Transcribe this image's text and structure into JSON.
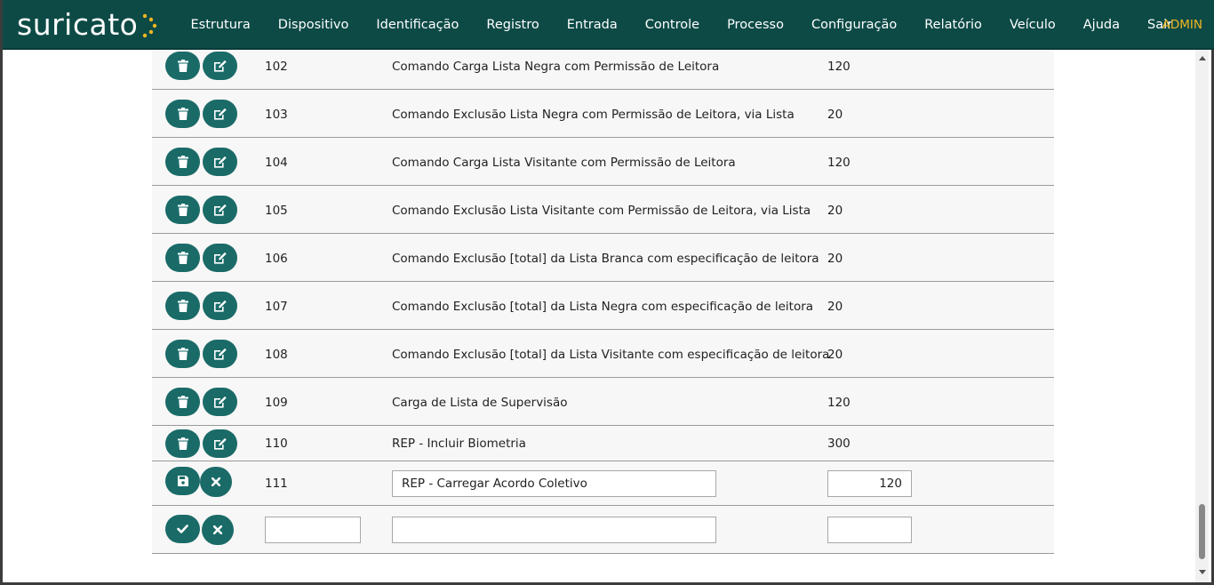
{
  "app": {
    "logo_text": "suricato"
  },
  "nav": {
    "items": [
      "Estrutura",
      "Dispositivo",
      "Identificação",
      "Registro",
      "Entrada",
      "Controle",
      "Processo",
      "Configuração",
      "Relatório",
      "Veículo",
      "Ajuda",
      "Sair"
    ],
    "user": "ADMIN"
  },
  "colors": {
    "navbar": "#0d4a46",
    "button": "#1a6b68",
    "user": "#f2b722"
  },
  "rows": [
    {
      "id": "102",
      "desc": "Comando Carga Lista Negra com Permissão de Leitora",
      "val": "120"
    },
    {
      "id": "103",
      "desc": "Comando Exclusão Lista Negra com Permissão de Leitora, via Lista",
      "val": "20"
    },
    {
      "id": "104",
      "desc": "Comando Carga Lista Visitante com Permissão de Leitora",
      "val": "120"
    },
    {
      "id": "105",
      "desc": "Comando Exclusão Lista Visitante com Permissão de Leitora, via Lista",
      "val": "20"
    },
    {
      "id": "106",
      "desc": "Comando Exclusão [total] da Lista Branca com especificação de leitora",
      "val": "20"
    },
    {
      "id": "107",
      "desc": "Comando Exclusão [total] da Lista Negra com especificação de leitora",
      "val": "20"
    },
    {
      "id": "108",
      "desc": "Comando Exclusão [total] da Lista Visitante com especificação de leitora",
      "val": "20"
    },
    {
      "id": "109",
      "desc": "Carga de Lista de Supervisão",
      "val": "120"
    },
    {
      "id": "110",
      "desc": "REP - Incluir Biometria",
      "val": "300"
    }
  ],
  "edit_row": {
    "id": "111",
    "desc": "REP - Carregar Acordo Coletivo",
    "val": "120"
  },
  "new_row": {
    "id": "",
    "desc": "",
    "val": ""
  },
  "icons": {
    "delete": "trash-icon",
    "edit": "edit-icon",
    "save": "save-icon",
    "cancel": "close-icon",
    "confirm": "check-icon"
  }
}
